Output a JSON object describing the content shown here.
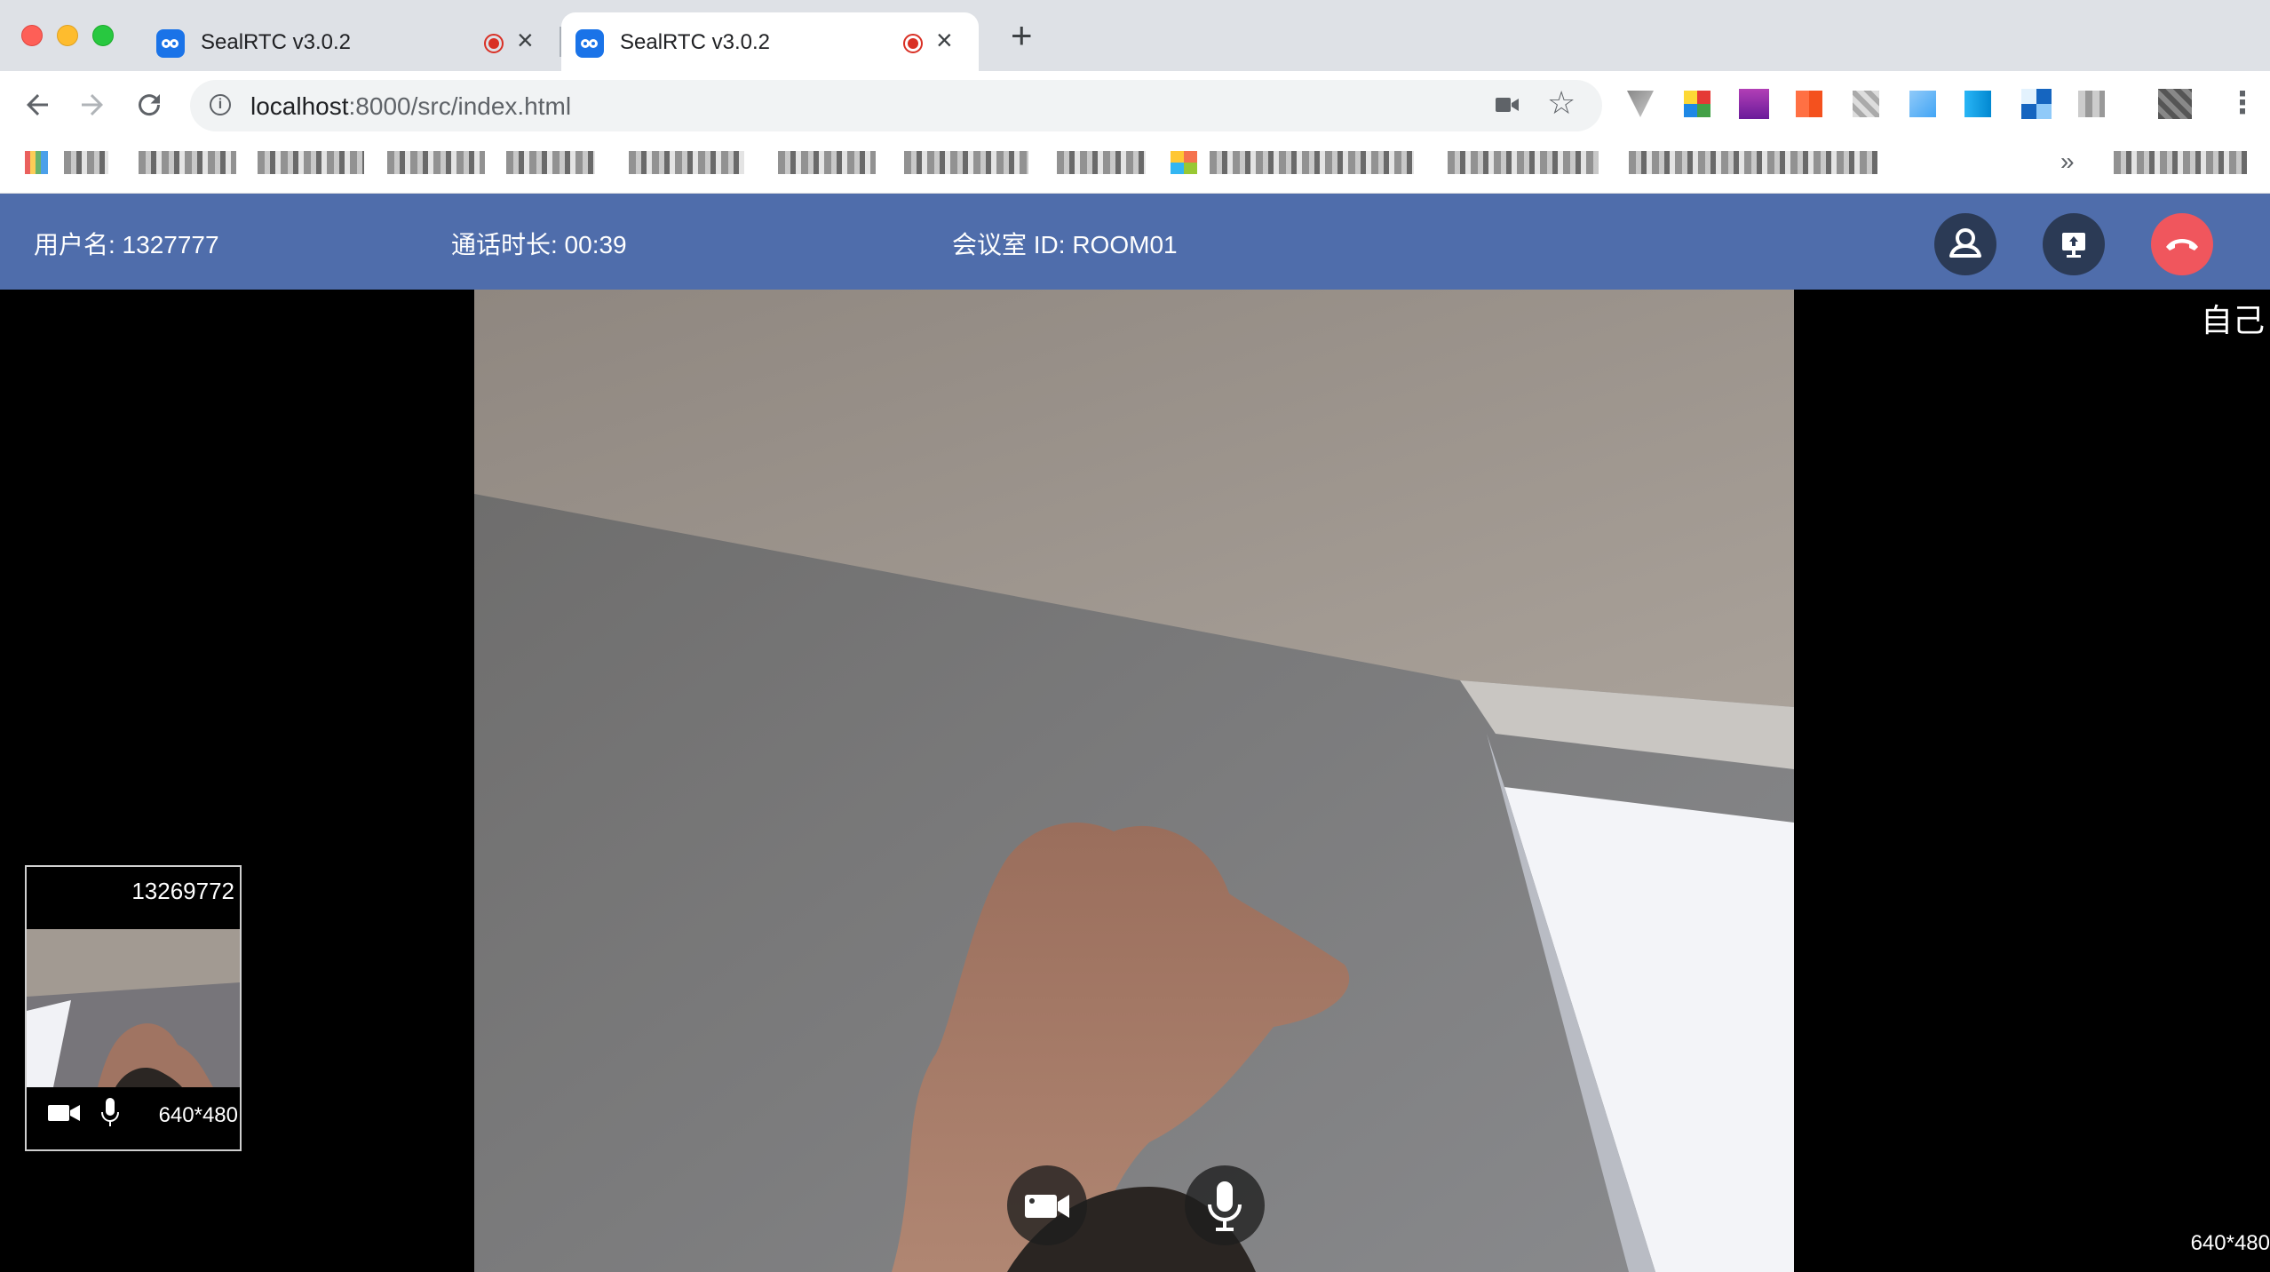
{
  "browser": {
    "tabs": [
      {
        "title": "SealRTC v3.0.2",
        "active": false
      },
      {
        "title": "SealRTC v3.0.2",
        "active": true
      }
    ],
    "url_host": "localhost",
    "url_rest": ":8000/src/index.html",
    "bookmarks_overflow": "»"
  },
  "header": {
    "username_label": "用户名: 1327777",
    "duration_label": "通话时长:  00:39",
    "room_label": "会议室 ID: ROOM01"
  },
  "stage": {
    "self_label": "自己",
    "main_resolution": "640*480"
  },
  "thumbnail": {
    "user_id": "13269772",
    "resolution": "640*480"
  },
  "colors": {
    "header_bg": "#4f6dab",
    "header_button_bg": "#2b3a55",
    "hangup_bg": "#f0565d"
  }
}
